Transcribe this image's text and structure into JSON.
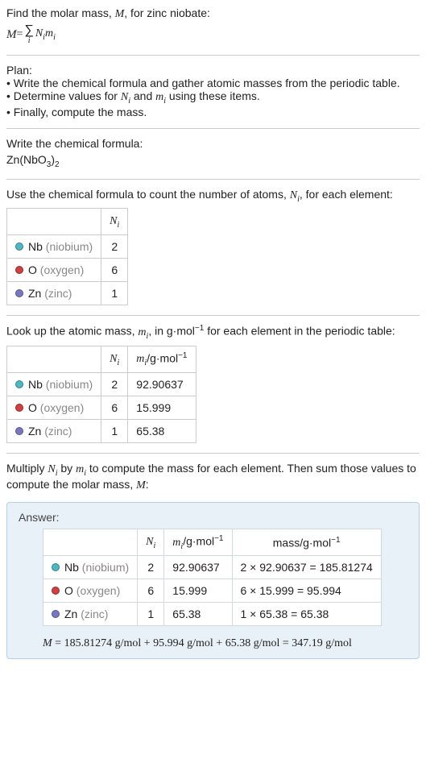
{
  "header": {
    "line1": "Find the molar mass, M, for zinc niobate:",
    "formula_left": "M = ",
    "formula_right": " NᵢMᵢ"
  },
  "plan": {
    "title": "Plan:",
    "bullet1": "• Write the chemical formula and gather atomic masses from the periodic table.",
    "bullet2": "• Determine values for Nᵢ and mᵢ using these items.",
    "bullet3": "• Finally, compute the mass."
  },
  "step1": {
    "title": "Write the chemical formula:",
    "formula": "Zn(NbO₃)₂"
  },
  "step2": {
    "title": "Use the chemical formula to count the number of atoms, Nᵢ, for each element:",
    "header_n": "Nᵢ",
    "rows": [
      {
        "color": "#4db8c4",
        "symbol": "Nb",
        "name": "(niobium)",
        "n": "2"
      },
      {
        "color": "#d04040",
        "symbol": "O",
        "name": "(oxygen)",
        "n": "6"
      },
      {
        "color": "#7878c0",
        "symbol": "Zn",
        "name": "(zinc)",
        "n": "1"
      }
    ]
  },
  "step3": {
    "title": "Look up the atomic mass, mᵢ, in g·mol⁻¹ for each element in the periodic table:",
    "header_n": "Nᵢ",
    "header_m": "mᵢ/g·mol⁻¹",
    "rows": [
      {
        "color": "#4db8c4",
        "symbol": "Nb",
        "name": "(niobium)",
        "n": "2",
        "m": "92.90637"
      },
      {
        "color": "#d04040",
        "symbol": "O",
        "name": "(oxygen)",
        "n": "6",
        "m": "15.999"
      },
      {
        "color": "#7878c0",
        "symbol": "Zn",
        "name": "(zinc)",
        "n": "1",
        "m": "65.38"
      }
    ]
  },
  "step4": {
    "title": "Multiply Nᵢ by mᵢ to compute the mass for each element. Then sum those values to compute the molar mass, M:"
  },
  "answer": {
    "label": "Answer:",
    "header_n": "Nᵢ",
    "header_m": "mᵢ/g·mol⁻¹",
    "header_mass": "mass/g·mol⁻¹",
    "rows": [
      {
        "color": "#4db8c4",
        "symbol": "Nb",
        "name": "(niobium)",
        "n": "2",
        "m": "92.90637",
        "mass": "2 × 92.90637 = 185.81274"
      },
      {
        "color": "#d04040",
        "symbol": "O",
        "name": "(oxygen)",
        "n": "6",
        "m": "15.999",
        "mass": "6 × 15.999 = 95.994"
      },
      {
        "color": "#7878c0",
        "symbol": "Zn",
        "name": "(zinc)",
        "n": "1",
        "m": "65.38",
        "mass": "1 × 65.38 = 65.38"
      }
    ],
    "final": "M = 185.81274 g/mol + 95.994 g/mol + 65.38 g/mol = 347.19 g/mol"
  }
}
